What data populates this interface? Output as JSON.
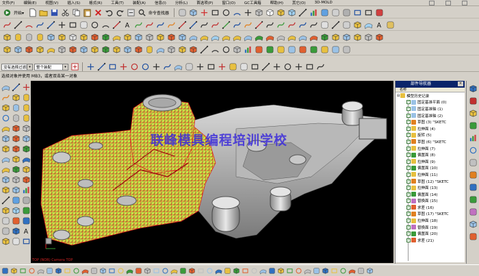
{
  "menu": {
    "items": [
      "文件(F)",
      "编辑(E)",
      "视图(V)",
      "插入(S)",
      "格式(R)",
      "工具(T)",
      "装配(A)",
      "信息(I)",
      "分析(L)",
      "首选项(P)",
      "窗口(O)",
      "GC工具箱",
      "帮助(H)",
      "其它(O)",
      "3D-MOLD"
    ]
  },
  "toolbar1": {
    "start_label": "开始▾",
    "command_finder_label": "命令查找器"
  },
  "selection_bar": {
    "filter_value": "没有选择过滤器",
    "assembly_scope": "整个装配"
  },
  "cue_line": "选择对象并使用 MB3，或者双击某一对象",
  "viewport": {
    "watermark": "联峰模具编程培训学校",
    "view_info": "TOP (NOR) Camera TOP"
  },
  "part_navigator": {
    "title": "部件导航器",
    "column_header": "名称",
    "root": "模型历史记录",
    "nodes": [
      "固定基准平面 (0)",
      "固定基准轴 (1)",
      "固定基准轴 (2)",
      "草图 (3) \"SKETC",
      "拉伸面 (4)",
      "旋转 (5)",
      "草图 (6) \"SKETC",
      "拉伸面 (7)",
      "偏置面 (8)",
      "拉伸面 (9)",
      "偏置面 (10)",
      "拉伸面 (11)",
      "草图 (12) \"SKETC",
      "拉伸面 (13)",
      "偏置面 (14)",
      "替换面 (15)",
      "求差 (16)",
      "草图 (17) \"SKETC",
      "拉伸面 (18)",
      "替换面 (19)",
      "偏置面 (20)",
      "求差 (21)"
    ]
  },
  "icons": {
    "toolbar": [
      "new-file-icon",
      "open-icon",
      "save-icon",
      "cut-icon",
      "copy-icon",
      "paste-icon",
      "undo-icon",
      "redo-icon",
      "command-finder-icon"
    ],
    "navigator": [
      "folder-icon",
      "datum-icon",
      "sketch-icon",
      "extrude-icon",
      "revolve-icon",
      "offset-icon",
      "replace-icon",
      "subtract-icon"
    ]
  },
  "colors": {
    "titlebar": "#0a246a",
    "ui_bg": "#d4d0c8",
    "viewport_bg": "#000000",
    "watermark": "#3c2cdb",
    "mesh_red": "#e02020",
    "mesh_yellow": "#d8e030",
    "part_gray": "#9a9a9a"
  }
}
